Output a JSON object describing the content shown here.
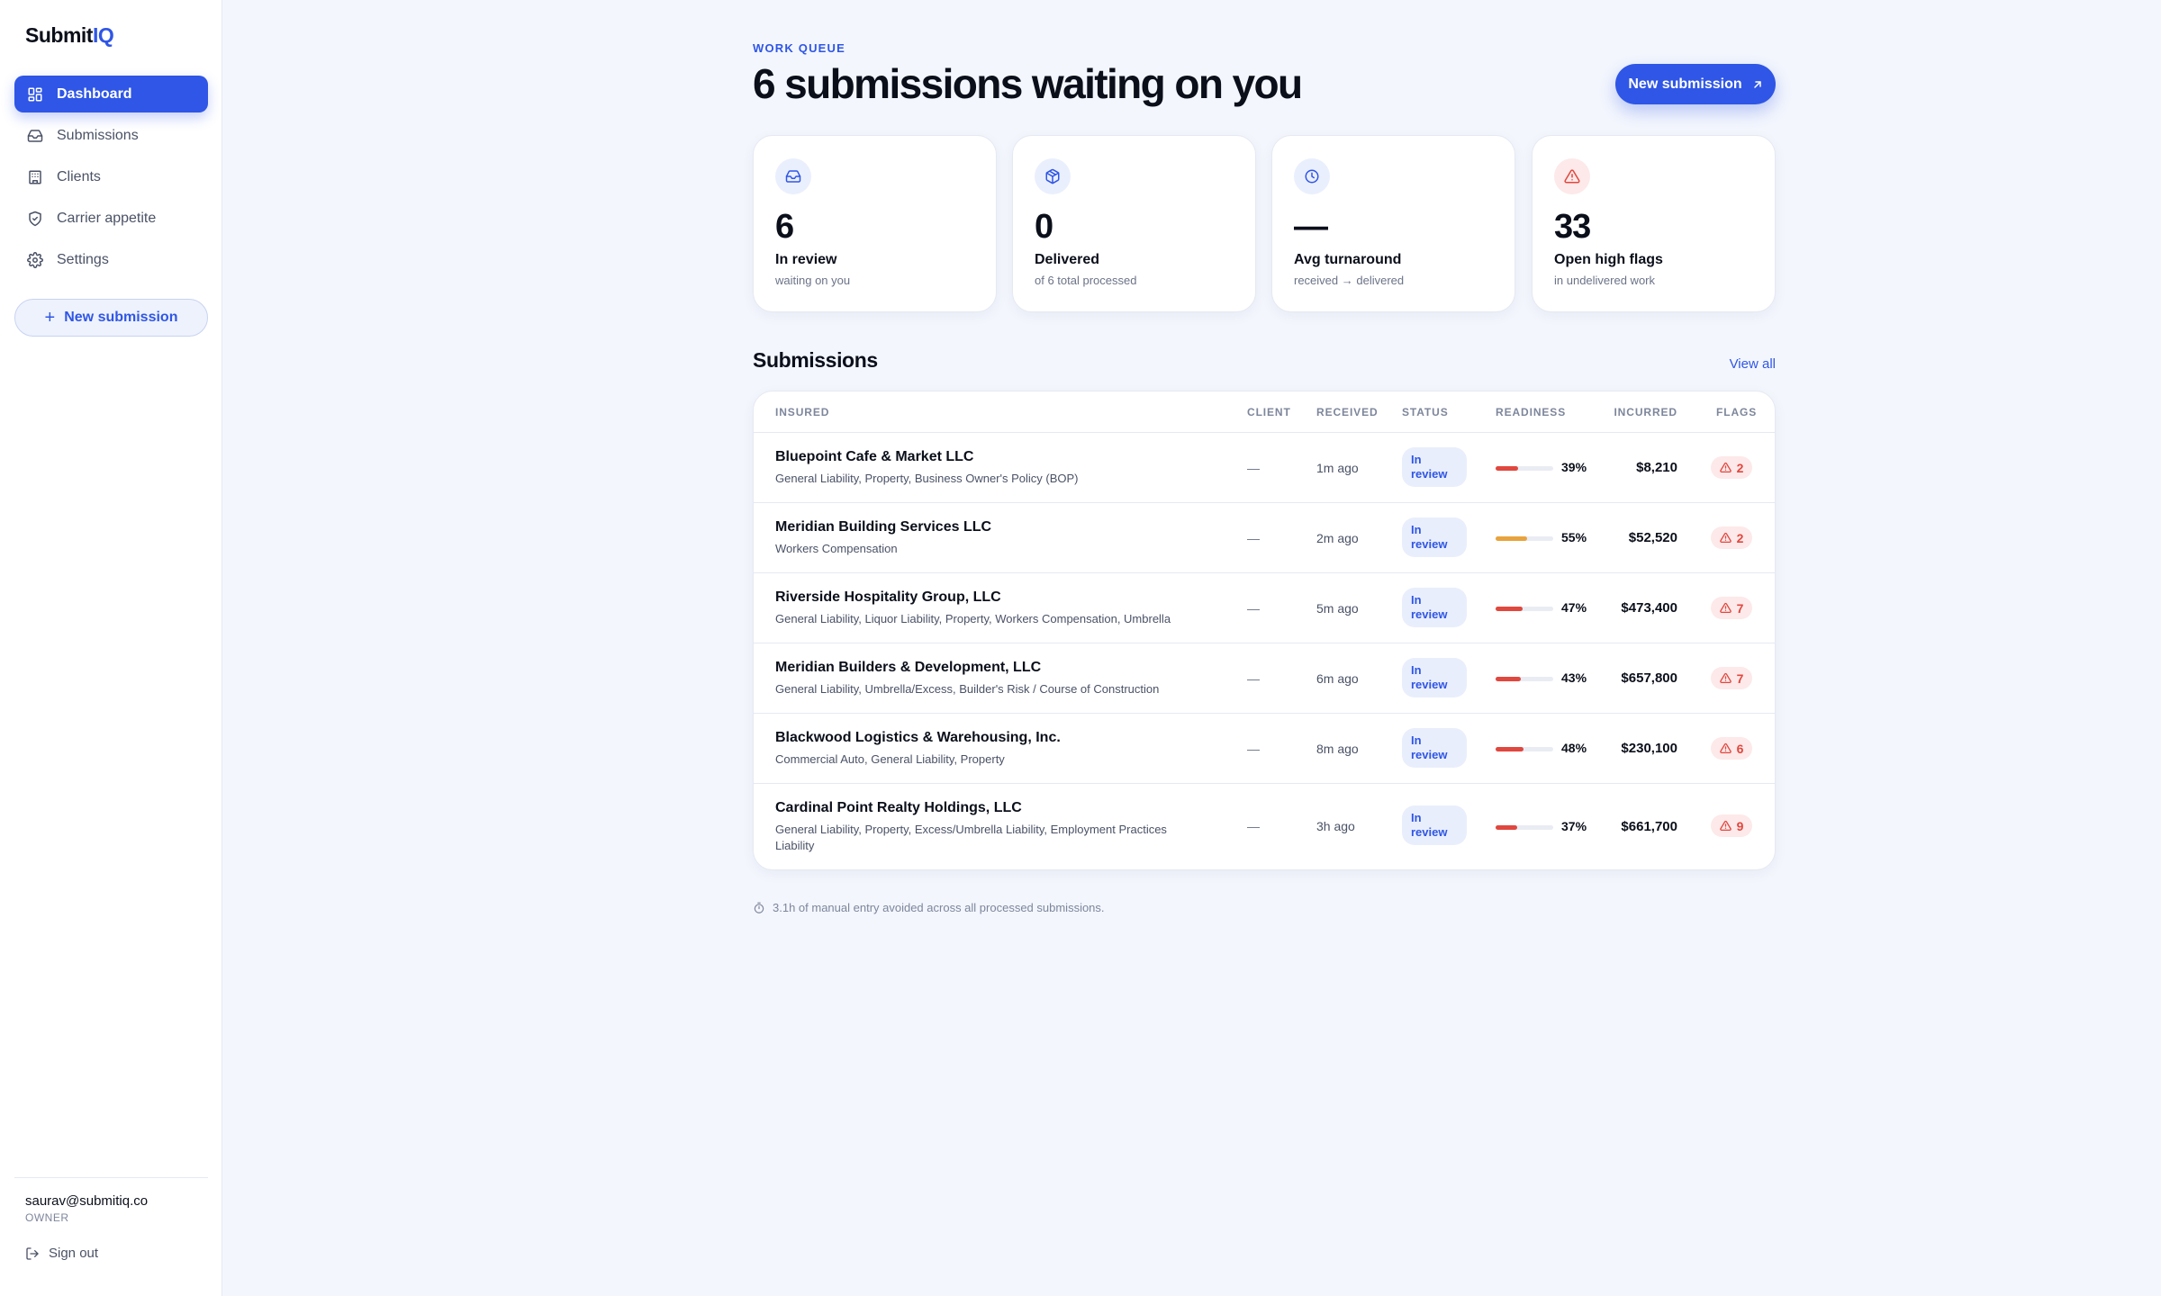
{
  "app": {
    "logo_main": "Submit",
    "logo_accent": "IQ"
  },
  "sidebar": {
    "items": [
      {
        "label": "Dashboard",
        "icon": "dashboard-icon",
        "active": true
      },
      {
        "label": "Submissions",
        "icon": "inbox-icon",
        "active": false
      },
      {
        "label": "Clients",
        "icon": "building-icon",
        "active": false
      },
      {
        "label": "Carrier appetite",
        "icon": "shield-icon",
        "active": false
      },
      {
        "label": "Settings",
        "icon": "gear-icon",
        "active": false
      }
    ],
    "new_submission_label": "New submission",
    "user_email": "saurav@submitiq.co",
    "user_role": "OWNER",
    "sign_out_label": "Sign out"
  },
  "header": {
    "eyebrow": "WORK QUEUE",
    "title": "6 submissions waiting on you",
    "new_submission_label": "New submission"
  },
  "stats": [
    {
      "icon": "inbox-icon",
      "value": "6",
      "label": "In review",
      "sub": "waiting on you",
      "tone": "blue"
    },
    {
      "icon": "package-icon",
      "value": "0",
      "label": "Delivered",
      "sub": "of 6 total processed",
      "tone": "blue"
    },
    {
      "icon": "clock-icon",
      "value": "—",
      "label": "Avg turnaround",
      "sub": "received → delivered",
      "tone": "blue"
    },
    {
      "icon": "alert-triangle-icon",
      "value": "33",
      "label": "Open high flags",
      "sub": "in undelivered work",
      "tone": "red"
    }
  ],
  "submissions": {
    "title": "Submissions",
    "view_all_label": "View all",
    "columns": {
      "insured": "INSURED",
      "client": "CLIENT",
      "received": "RECEIVED",
      "status": "STATUS",
      "readiness": "READINESS",
      "incurred": "INCURRED",
      "flags": "FLAGS"
    },
    "rows": [
      {
        "name": "Bluepoint Cafe & Market LLC",
        "lines": "General Liability, Property, Business Owner's Policy (BOP)",
        "client": "—",
        "received": "1m ago",
        "status": "In review",
        "readiness": 39,
        "readiness_label": "39%",
        "incurred": "$8,210",
        "flags": "2"
      },
      {
        "name": "Meridian Building Services LLC",
        "lines": "Workers Compensation",
        "client": "—",
        "received": "2m ago",
        "status": "In review",
        "readiness": 55,
        "readiness_label": "55%",
        "incurred": "$52,520",
        "flags": "2"
      },
      {
        "name": "Riverside Hospitality Group, LLC",
        "lines": "General Liability, Liquor Liability, Property, Workers Compensation, Umbrella",
        "client": "—",
        "received": "5m ago",
        "status": "In review",
        "readiness": 47,
        "readiness_label": "47%",
        "incurred": "$473,400",
        "flags": "7"
      },
      {
        "name": "Meridian Builders & Development, LLC",
        "lines": "General Liability, Umbrella/Excess, Builder's Risk / Course of Construction",
        "client": "—",
        "received": "6m ago",
        "status": "In review",
        "readiness": 43,
        "readiness_label": "43%",
        "incurred": "$657,800",
        "flags": "7"
      },
      {
        "name": "Blackwood Logistics & Warehousing, Inc.",
        "lines": "Commercial Auto, General Liability, Property",
        "client": "—",
        "received": "8m ago",
        "status": "In review",
        "readiness": 48,
        "readiness_label": "48%",
        "incurred": "$230,100",
        "flags": "6"
      },
      {
        "name": "Cardinal Point Realty Holdings, LLC",
        "lines": "General Liability, Property, Excess/Umbrella Liability, Employment Practices Liability",
        "client": "—",
        "received": "3h ago",
        "status": "In review",
        "readiness": 37,
        "readiness_label": "37%",
        "incurred": "$661,700",
        "flags": "9"
      }
    ]
  },
  "footnote": "3.1h of manual entry avoided across all processed submissions.",
  "colors": {
    "accent": "#2f56e6",
    "danger": "#e0473e",
    "warning": "#e8a33d",
    "background": "#f3f6fd"
  }
}
